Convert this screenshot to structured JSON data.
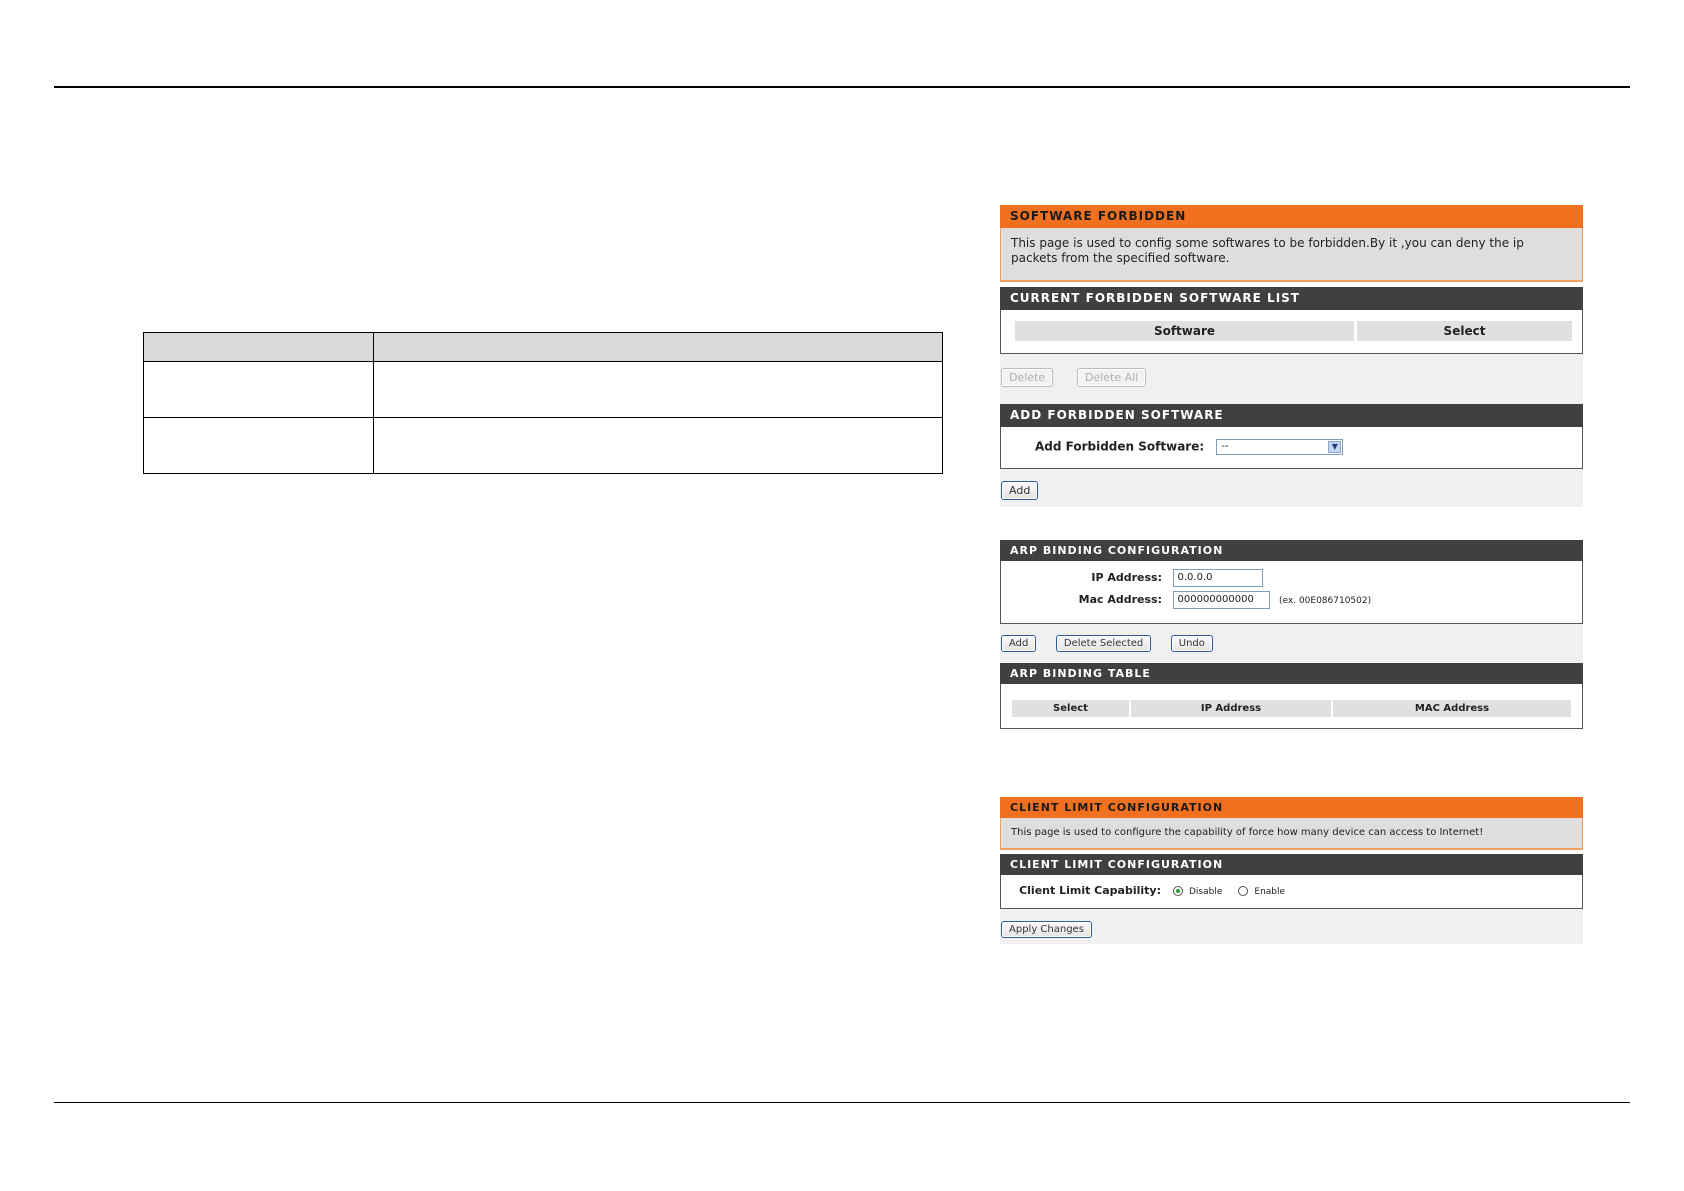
{
  "manual_table": {
    "headers": [
      "",
      ""
    ],
    "rows": [
      [
        "",
        ""
      ],
      [
        "",
        ""
      ]
    ]
  },
  "software_forbidden": {
    "title": "SOFTWARE FORBIDDEN",
    "description": "This page is used to config some softwares to be forbidden.By it ,you can deny the ip packets from the specified software.",
    "list_title": "CURRENT FORBIDDEN SOFTWARE LIST",
    "columns": [
      "Software",
      "Select"
    ],
    "delete_label": "Delete",
    "delete_all_label": "Delete All",
    "add_title": "ADD FORBIDDEN SOFTWARE",
    "add_field_label": "Add Forbidden Software:",
    "add_select_value": "--",
    "add_label": "Add"
  },
  "arp_binding": {
    "title": "ARP BINDING CONFIGURATION",
    "ip_label": "IP Address:",
    "ip_value": "0.0.0.0",
    "mac_label": "Mac Address:",
    "mac_value": "000000000000",
    "mac_example": "(ex. 00E086710502)",
    "add_label": "Add",
    "delete_selected_label": "Delete Selected",
    "undo_label": "Undo",
    "table_title": "ARP BINDING TABLE",
    "columns": [
      "Select",
      "IP Address",
      "MAC Address"
    ]
  },
  "client_limit": {
    "title": "CLIENT LIMIT CONFIGURATION",
    "description": "This page is used to configure the capability of force how many device can access to Internet!",
    "section_title": "CLIENT LIMIT CONFIGURATION",
    "capability_label": "Client Limit Capability:",
    "options": [
      "Disable",
      "Enable"
    ],
    "selected": "Disable",
    "apply_label": "Apply Changes"
  },
  "colors": {
    "orange": "#f07020",
    "dark_bar": "#404040"
  }
}
